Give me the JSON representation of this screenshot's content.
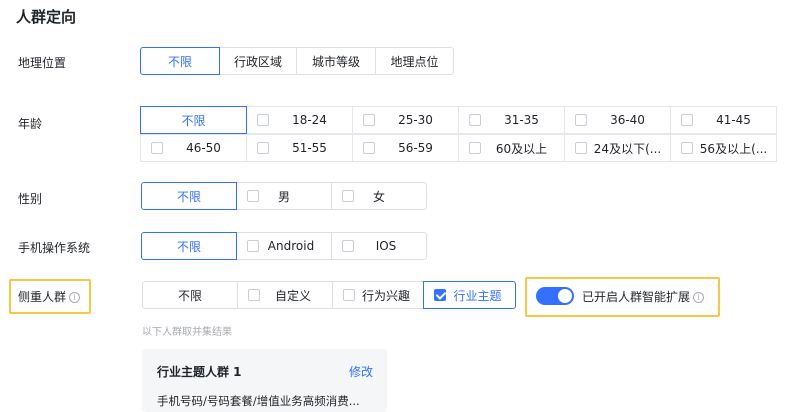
{
  "section_title": "人群定向",
  "location": {
    "label": "地理位置",
    "options": [
      "不限",
      "行政区域",
      "城市等级",
      "地理点位"
    ],
    "selected": "不限"
  },
  "age": {
    "label": "年龄",
    "row1": [
      "不限",
      "18-24",
      "25-30",
      "31-35",
      "36-40",
      "41-45"
    ],
    "row2": [
      "46-50",
      "51-55",
      "56-59",
      "60及以上",
      "24及以下(...",
      "56及以上(..."
    ],
    "selected": "不限"
  },
  "gender": {
    "label": "性别",
    "options": [
      "不限",
      "男",
      "女"
    ],
    "selected": "不限"
  },
  "os": {
    "label": "手机操作系统",
    "options": [
      "不限",
      "Android",
      "IOS"
    ],
    "selected": "不限"
  },
  "focus": {
    "label": "侧重人群",
    "info_glyph": "i",
    "options": [
      "不限",
      "自定义",
      "行为兴趣",
      "行业主题"
    ],
    "checked": "行业主题",
    "toggle_label": "已开启人群智能扩展",
    "toggle_on": true,
    "hint": "以下人群取并集结果"
  },
  "card": {
    "title": "行业主题人群 1",
    "edit_label": "修改",
    "desc": "手机号码/号码套餐/增值业务高频消费..."
  },
  "colors": {
    "accent": "#3370ff",
    "highlight_border": "#f6c744",
    "border": "#dcdfe6",
    "hint_text": "#a8abb2",
    "card_bg": "#f5f6f7"
  },
  "icons": {
    "info": "info-circle-icon",
    "checkbox_checked": "checkbox-checked-icon",
    "checkbox_empty": "checkbox-empty-icon"
  }
}
